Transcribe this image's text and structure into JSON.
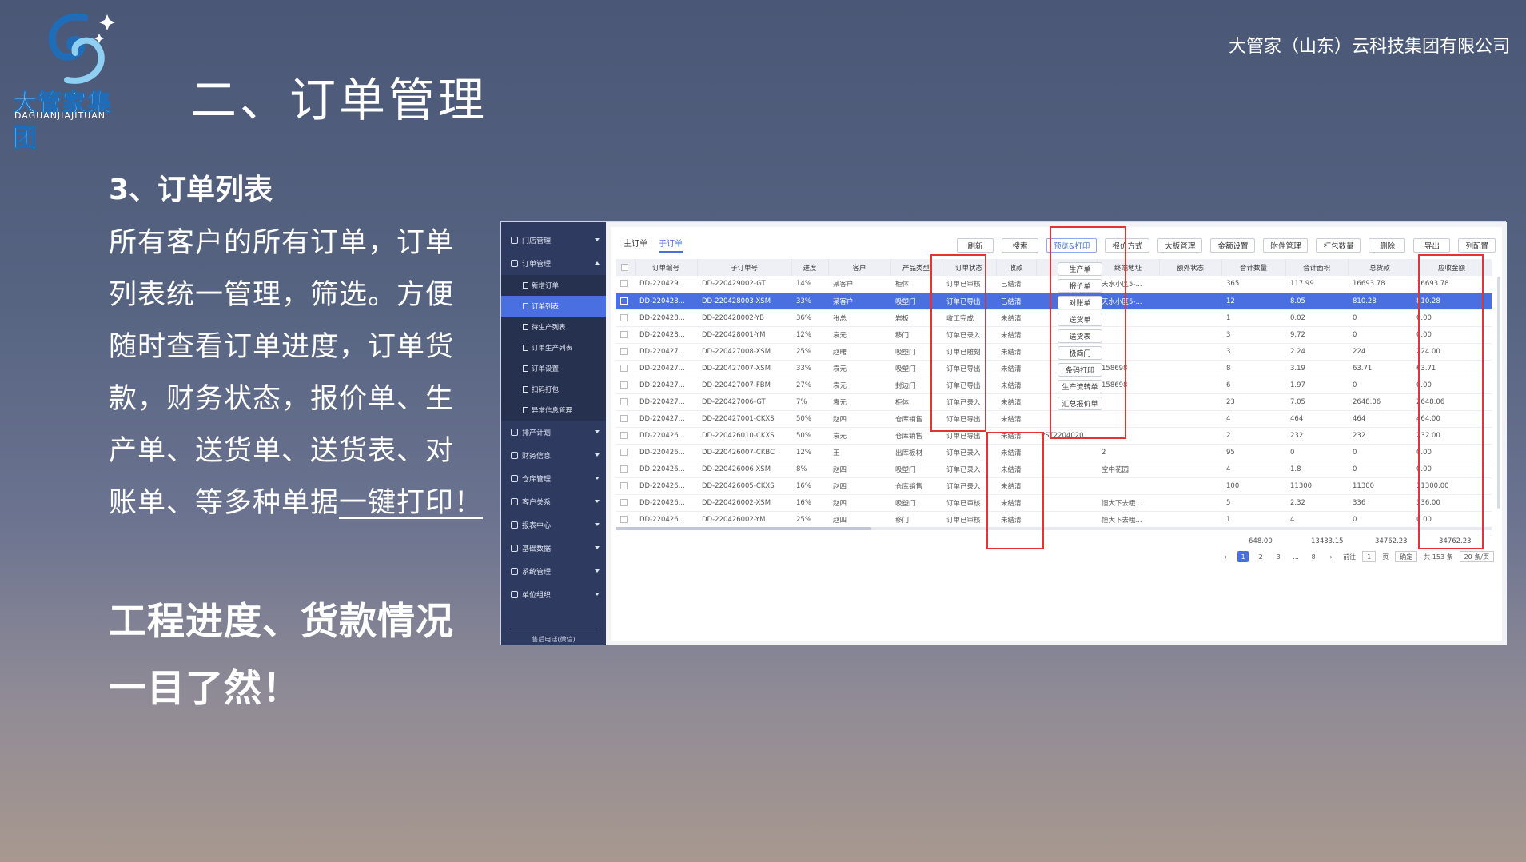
{
  "logo": {
    "name_cn": "大管家集团",
    "name_en": "DAGUANJIAJITUAN",
    "colors": {
      "primary": "#1f6db8",
      "light": "#8fd0f2"
    }
  },
  "company": "大管家（山东）云科技集团有限公司",
  "slide_title": "二、订单管理",
  "section_title": "3、订单列表",
  "paragraph": {
    "lines": [
      "所有客户的所有订单，订单",
      "列表统一管理，筛选。方便",
      "随时查看订单进度，订单货",
      "款，财务状态，报价单、生",
      "产单、送货单、送货表、对",
      "账单、等多种单据"
    ],
    "emphasis": "一键打印！"
  },
  "highlight_lines": [
    "工程进度、货款情况",
    "一目了然！"
  ],
  "app": {
    "sidebar": {
      "items": [
        {
          "label": "门店管理",
          "expanded": false
        },
        {
          "label": "订单管理",
          "expanded": true,
          "children": [
            "新增订单",
            "订单列表",
            "待生产列表",
            "订单生产列表",
            "订单设置",
            "扫码打包",
            "异常信息管理"
          ],
          "active_child": "订单列表"
        },
        {
          "label": "排产计划",
          "expanded": false
        },
        {
          "label": "财务信息",
          "expanded": false
        },
        {
          "label": "仓库管理",
          "expanded": false
        },
        {
          "label": "客户关系",
          "expanded": false
        },
        {
          "label": "报表中心",
          "expanded": false
        },
        {
          "label": "基础数据",
          "expanded": false
        },
        {
          "label": "系统管理",
          "expanded": false
        },
        {
          "label": "单位组织",
          "expanded": false
        }
      ],
      "footer": "售后电话(微信)"
    },
    "tabs": [
      {
        "label": "主订单",
        "active": false
      },
      {
        "label": "子订单",
        "active": true
      }
    ],
    "toolbar": [
      "刷新",
      "搜索",
      "预览&打印",
      "报价方式",
      "大板管理",
      "金额设置",
      "附件管理",
      "打包数量",
      "删除",
      "导出",
      "列配置"
    ],
    "print_menu": [
      "生产单",
      "报价单",
      "对账单",
      "送货单",
      "送货表",
      "极简门",
      "条码打印",
      "生产流转单",
      "汇总报价单"
    ],
    "columns": [
      "订单编号",
      "子订单号",
      "进度",
      "客户",
      "产品类型",
      "订单状态",
      "收款",
      "",
      "终端地址",
      "额外状态",
      "合计数量",
      "合计面积",
      "总货款",
      "应收金额"
    ],
    "rows": [
      [
        "DD-220429...",
        "DD-220429002-GT",
        "14%",
        "某客户",
        "柜体",
        "订单已审核",
        "已结清",
        "",
        "天水小区5-...",
        "",
        "365",
        "117.99",
        "16693.78",
        "16693.78"
      ],
      [
        "DD-220428...",
        "DD-220428003-XSM",
        "33%",
        "某客户",
        "吸塑门",
        "订单已导出",
        "已结清",
        "",
        "天水小区5-...",
        "",
        "12",
        "8.05",
        "810.28",
        "810.28"
      ],
      [
        "DD-220428...",
        "DD-220428002-YB",
        "36%",
        "张总",
        "岩板",
        "收工完成",
        "未结清",
        "",
        "",
        "",
        "1",
        "0.02",
        "0",
        "0.00"
      ],
      [
        "DD-220428...",
        "DD-220428001-YM",
        "12%",
        "袁元",
        "移门",
        "订单已录入",
        "未结清",
        "",
        "",
        "",
        "3",
        "9.72",
        "0",
        "0.00"
      ],
      [
        "DD-220427...",
        "DD-220427008-XSM",
        "25%",
        "赵曙",
        "吸塑门",
        "订单已雕刻",
        "未结清",
        "",
        "",
        "",
        "3",
        "2.24",
        "224",
        "224.00"
      ],
      [
        "DD-220427...",
        "DD-220427007-XSM",
        "33%",
        "袁元",
        "吸塑门",
        "订单已导出",
        "未结清",
        "",
        "158698",
        "",
        "8",
        "3.19",
        "63.71",
        "63.71"
      ],
      [
        "DD-220427...",
        "DD-220427007-FBM",
        "27%",
        "袁元",
        "封边门",
        "订单已导出",
        "未结清",
        "",
        "158698",
        "",
        "6",
        "1.97",
        "0",
        "0.00"
      ],
      [
        "DD-220427...",
        "DD-220427006-GT",
        "7%",
        "袁元",
        "柜体",
        "订单已录入",
        "未结清",
        "",
        "",
        "",
        "23",
        "7.05",
        "2648.06",
        "2648.06"
      ],
      [
        "DD-220427...",
        "DD-220427001-CKXS",
        "50%",
        "赵四",
        "仓库销售",
        "订单已导出",
        "未结清",
        "",
        "",
        "",
        "4",
        "464",
        "464",
        "464.00"
      ],
      [
        "DD-220426...",
        "DD-220426010-CKXS",
        "50%",
        "袁元",
        "仓库销售",
        "订单已导出",
        "未结清",
        "PST2204020",
        "",
        "",
        "2",
        "232",
        "232",
        "232.00"
      ],
      [
        "DD-220426...",
        "DD-220426007-CKBC",
        "12%",
        "王",
        "出库板材",
        "订单已录入",
        "未结清",
        "",
        "2",
        "",
        "95",
        "0",
        "0",
        "0.00"
      ],
      [
        "DD-220426...",
        "DD-220426006-XSM",
        "8%",
        "赵四",
        "吸塑门",
        "订单已录入",
        "未结清",
        "",
        "空中花园",
        "",
        "4",
        "1.8",
        "0",
        "0.00"
      ],
      [
        "DD-220426...",
        "DD-220426005-CKXS",
        "16%",
        "赵四",
        "仓库销售",
        "订单已录入",
        "未结清",
        "",
        "",
        "",
        "100",
        "11300",
        "11300",
        "11300.00"
      ],
      [
        "DD-220426...",
        "DD-220426002-XSM",
        "16%",
        "赵四",
        "吸塑门",
        "订单已审核",
        "未结清",
        "",
        "恒大下去哦...",
        "",
        "5",
        "2.32",
        "336",
        "336.00"
      ],
      [
        "DD-220426...",
        "DD-220426002-YM",
        "25%",
        "赵四",
        "移门",
        "订单已审核",
        "未结清",
        "",
        "恒大下去哦...",
        "",
        "1",
        "4",
        "0",
        "0.00"
      ]
    ],
    "selected_row": 1,
    "totals": {
      "qty": "648.00",
      "area": "13433.15",
      "goods": "34762.23",
      "receivable": "34762.23"
    },
    "pager": {
      "pages": [
        "1",
        "2",
        "3",
        "...",
        "8"
      ],
      "current": "1",
      "goto_label": "前往",
      "goto_value": "1",
      "page_unit": "页",
      "confirm": "确定",
      "total": "共 153 条",
      "page_size": "20 条/页"
    }
  }
}
